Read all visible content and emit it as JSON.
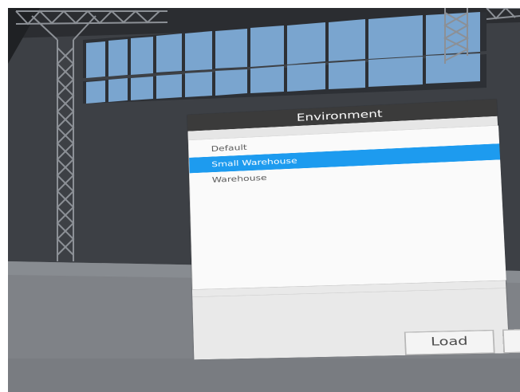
{
  "dialog": {
    "title": "Environment",
    "items": [
      {
        "label": "Default",
        "selected": false
      },
      {
        "label": "Small Warehouse",
        "selected": true
      },
      {
        "label": "Warehouse",
        "selected": false
      }
    ],
    "buttons": {
      "load_label": "Load"
    }
  },
  "colors": {
    "selection": "#1d9bef",
    "titlebar": "#3b3b3b",
    "wall": "#3e4146",
    "floor": "#7f8287",
    "window_glass": "#7aa5cf"
  }
}
